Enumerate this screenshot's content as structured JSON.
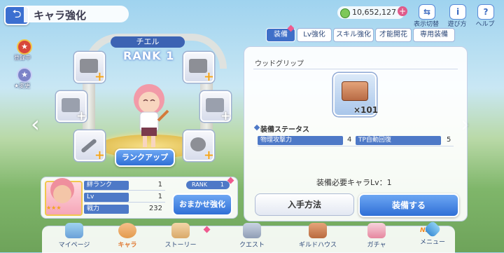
{
  "header": {
    "title": "キャラ強化",
    "currency": "10,652,127"
  },
  "top_buttons": [
    {
      "label": "表示切替",
      "icon": "display-toggle-icon"
    },
    {
      "label": "遊び方",
      "icon": "info-icon"
    },
    {
      "label": "ヘルプ",
      "icon": "help-icon"
    }
  ],
  "side": {
    "registered": "登録中",
    "change": "★変更"
  },
  "character": {
    "name": "チエル",
    "rank": "RANK 1",
    "rank_up": "ランクアップ"
  },
  "info": {
    "bond_label": "絆ランク",
    "bond_value": "1",
    "lv_label": "Lv",
    "lv_value": "1",
    "power_label": "戦力",
    "power_value": "232",
    "rank_badge_label": "RANK",
    "rank_badge_value": "1",
    "auto_button": "おまかせ強化"
  },
  "tabs": [
    "装備",
    "Lv強化",
    "スキル強化",
    "才能開花",
    "専用装備"
  ],
  "equipment": {
    "item_name": "ウッドグリップ",
    "count": "×101",
    "section_title": "装備ステータス",
    "stats": [
      {
        "label": "物理攻撃力",
        "value": "4"
      },
      {
        "label": "TP自動回復",
        "value": "5"
      }
    ],
    "requirement": "装備必要キャラLv：1",
    "obtain_button": "入手方法",
    "equip_button": "装備する"
  },
  "nav": [
    {
      "label": "マイページ"
    },
    {
      "label": "キャラ"
    },
    {
      "label": "ストーリー"
    },
    {
      "label": "クエスト"
    },
    {
      "label": "ギルドハウス"
    },
    {
      "label": "ガチャ"
    },
    {
      "label": "メニュー"
    }
  ],
  "nav_new": "NEW",
  "colors": {
    "accent": "#3f6fc8",
    "gold": "#f2a41c",
    "badge_pink": "#ef5a8f"
  }
}
